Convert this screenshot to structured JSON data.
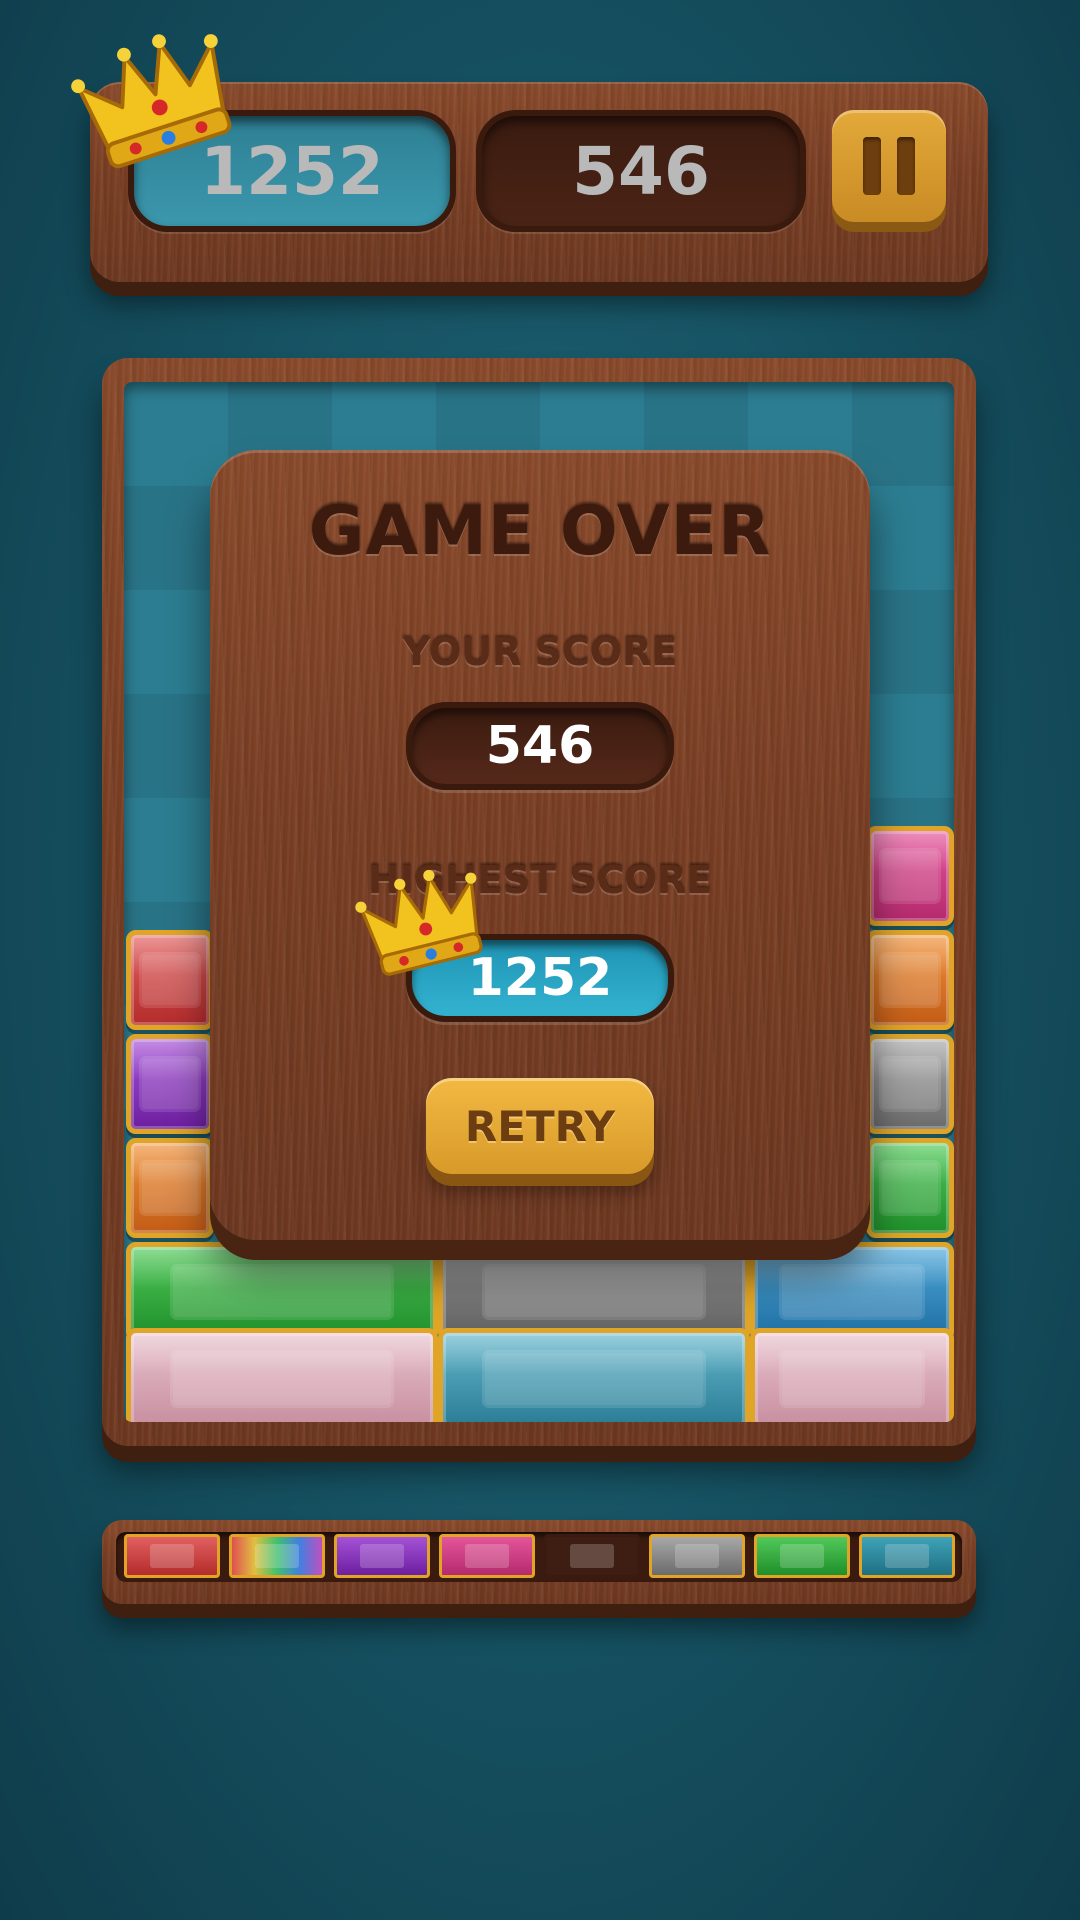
{
  "header": {
    "best_score": "1252",
    "current_score": "546"
  },
  "modal": {
    "title": "GAME OVER",
    "your_score_label": "YOUR SCORE",
    "your_score": "546",
    "highest_score_label": "HIGHEST SCORE",
    "highest_score": "1252",
    "retry_label": "RETRY"
  },
  "colors": {
    "background": "#174f5f",
    "wood": "#7a3f24",
    "gold_border": "#e0a526",
    "best_pill": "#3b98ad",
    "retry": "#e5a935"
  },
  "icons": {
    "pause": "pause-icon",
    "crown": "crown-icon"
  },
  "board_gems": [
    {
      "color": "magenta"
    },
    {
      "color": "red"
    },
    {
      "color": "orange"
    },
    {
      "color": "purple"
    },
    {
      "color": "gray"
    },
    {
      "color": "orange"
    },
    {
      "color": "green"
    },
    {
      "color": "green"
    },
    {
      "color": "gray"
    },
    {
      "color": "blue"
    },
    {
      "color": "pink"
    },
    {
      "color": "blue"
    },
    {
      "color": "pink"
    }
  ],
  "tray_gems": [
    {
      "color": "red"
    },
    {
      "color": "rainbow"
    },
    {
      "color": "purple"
    },
    {
      "color": "magenta"
    },
    {
      "color": "empty"
    },
    {
      "color": "gray"
    },
    {
      "color": "green"
    },
    {
      "color": "teal"
    }
  ]
}
